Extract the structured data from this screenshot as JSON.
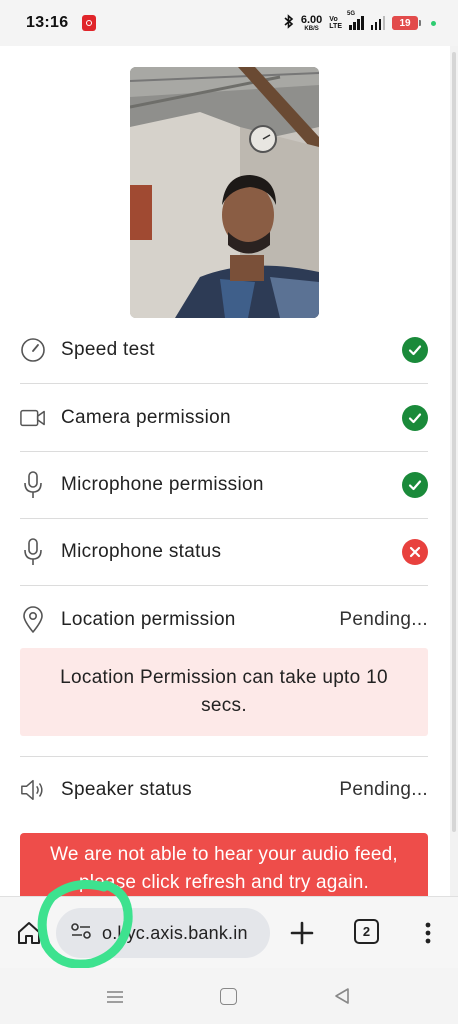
{
  "status_bar": {
    "time": "13:16",
    "network_speed": "6.00",
    "network_speed_unit": "KB/S",
    "volte_top": "Vo",
    "volte_bottom": "LTE",
    "signal_label": "5G",
    "battery": "19",
    "icons": [
      "app-badge-icon",
      "bluetooth-icon",
      "signal-icon",
      "battery-icon"
    ]
  },
  "checks": [
    {
      "label": "Speed test",
      "icon": "speedometer-icon",
      "status": "success"
    },
    {
      "label": "Camera permission",
      "icon": "camera-icon",
      "status": "success"
    },
    {
      "label": "Microphone permission",
      "icon": "microphone-icon",
      "status": "success"
    },
    {
      "label": "Microphone status",
      "icon": "microphone-icon",
      "status": "error"
    },
    {
      "label": "Location permission",
      "icon": "location-pin-icon",
      "status_text": "Pending..."
    },
    {
      "label": "Speaker status",
      "icon": "speaker-icon",
      "status_text": "Pending..."
    }
  ],
  "location_info": "Location Permission can take upto 10 secs.",
  "audio_error": "We are not able to hear your audio feed, please click refresh and try again.",
  "browser": {
    "url": "o.kyc.axis.bank.in",
    "tab_count": "2"
  },
  "colors": {
    "success": "#1a8a3a",
    "error": "#e8413e",
    "info_bg": "#fde9e8",
    "error_bg": "#ee4d4a",
    "annotation": "#3de28f"
  }
}
